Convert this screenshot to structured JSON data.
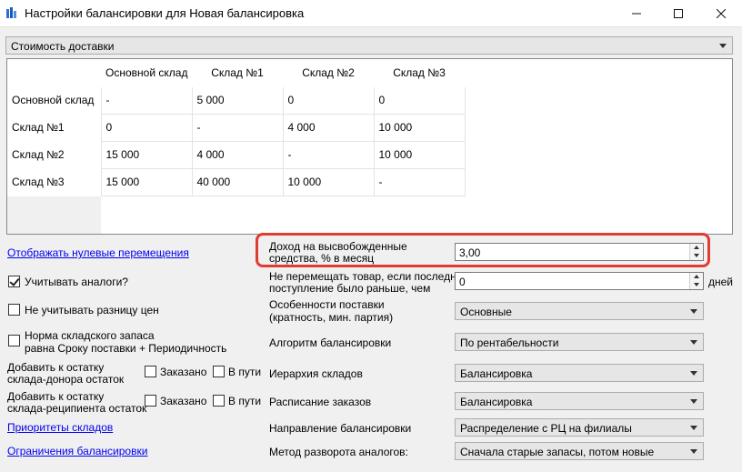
{
  "window": {
    "title": "Настройки балансировки для Новая балансировка"
  },
  "top_combo": {
    "value": "Стоимость доставки"
  },
  "grid": {
    "columns": [
      "Основной склад",
      "Склад №1",
      "Склад №2",
      "Склад №3"
    ],
    "rows": [
      {
        "label": "Основной склад",
        "cells": [
          "-",
          "5 000",
          "0",
          "0"
        ]
      },
      {
        "label": "Склад №1",
        "cells": [
          "0",
          "-",
          "4 000",
          "10 000"
        ]
      },
      {
        "label": "Склад №2",
        "cells": [
          "15 000",
          "4 000",
          "-",
          "10 000"
        ]
      },
      {
        "label": "Склад №3",
        "cells": [
          "15 000",
          "40 000",
          "10 000",
          "-"
        ]
      }
    ]
  },
  "left": {
    "show_zero_link": "Отображать нулевые перемещения",
    "analogs": {
      "label": "Учитывать аналоги?",
      "checked": true
    },
    "price_diff": {
      "label": "Не учитывать разницу цен",
      "checked": false
    },
    "stock_norm": {
      "line1": "Норма складского запаса",
      "line2": "равна Сроку поставки + Периодичность",
      "checked": false
    },
    "donor": {
      "line1": "Добавить к остатку",
      "line2": "склада-донора остаток",
      "ordered": "Заказано",
      "in_transit": "В пути"
    },
    "recipient": {
      "line1": "Добавить к остатку",
      "line2": "склада-реципиента остаток",
      "ordered": "Заказано",
      "in_transit": "В пути"
    },
    "priorities_link": "Приоритеты складов",
    "limits_link": "Ограничения балансировки"
  },
  "right": {
    "income": {
      "line1": "Доход на высвобожденные",
      "line2": "средства, % в месяц",
      "value": "3,00"
    },
    "no_move": {
      "line1": "Не перемещать товар, если последнее",
      "line2": "поступление было раньше, чем",
      "value": "0",
      "unit": "дней"
    },
    "delivery": {
      "line1": "Особенности поставки",
      "line2": "(кратность, мин. партия)",
      "value": "Основные"
    },
    "algorithm": {
      "label": "Алгоритм балансировки",
      "value": "По рентабельности"
    },
    "hierarchy": {
      "label": "Иерархия складов",
      "value": "Балансировка"
    },
    "schedule": {
      "label": "Расписание заказов",
      "value": "Балансировка"
    },
    "direction": {
      "label": "Направление балансировки",
      "value": "Распределение с РЦ на филиалы"
    },
    "analog_method": {
      "label": "Метод разворота аналогов:",
      "value": "Сначала старые запасы, потом новые"
    }
  },
  "colors": {
    "highlight": "#e03c31",
    "link": "#0000ee",
    "background": "#f0f0f0"
  }
}
